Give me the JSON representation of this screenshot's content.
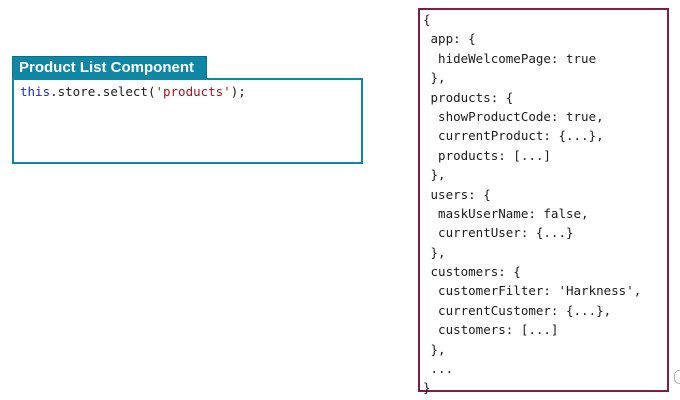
{
  "component": {
    "title": "Product List Component",
    "code": {
      "keyword": "this",
      "call": ".store.select(",
      "argument": "'products'",
      "end": ");"
    }
  },
  "state_lines": [
    "{",
    " app: {",
    "  hideWelcomePage: true",
    " },",
    " products: {",
    "  showProductCode: true,",
    "  currentProduct: {...},",
    "  products: [...]",
    " },",
    " users: {",
    "  maskUserName: false,",
    "  currentUser: {...}",
    " },",
    " customers: {",
    "  customerFilter: 'Harkness',",
    "  currentCustomer: {...},",
    "  customers: [...]",
    " },",
    " ...",
    "}"
  ]
}
